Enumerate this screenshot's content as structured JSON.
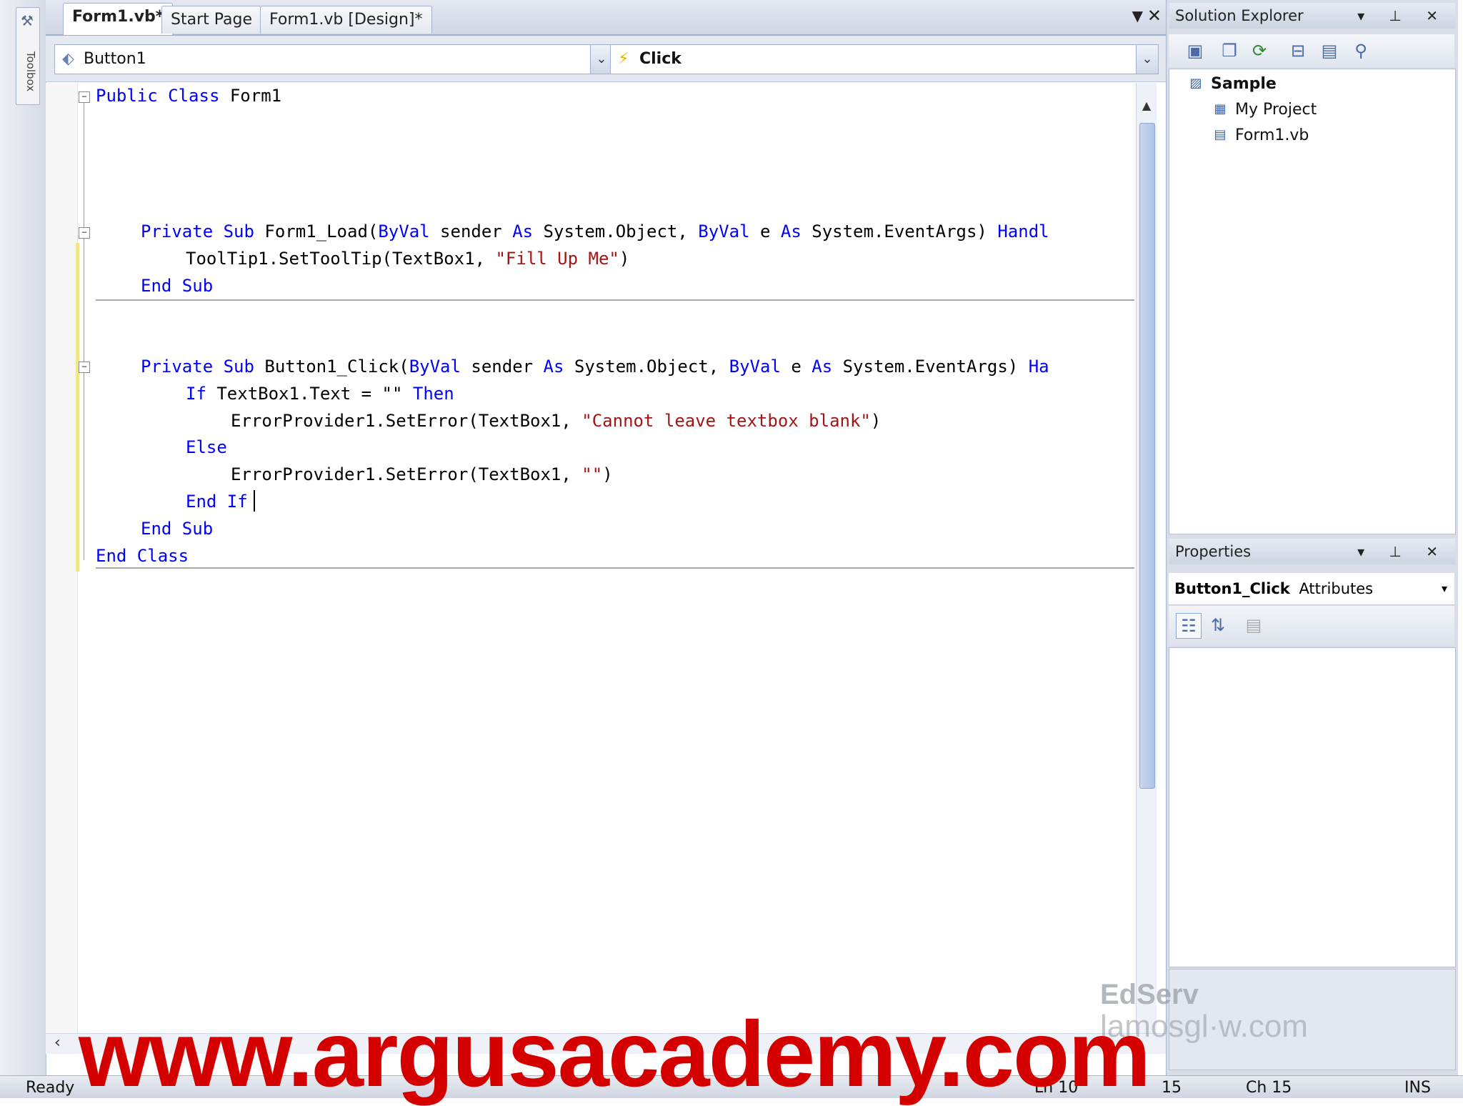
{
  "toolbox": {
    "label": "Toolbox",
    "icon": "toolbox-icon"
  },
  "tabs": [
    {
      "label": "Form1.vb*",
      "active": true
    },
    {
      "label": "Start Page",
      "active": false
    },
    {
      "label": "Form1.vb [Design]*",
      "active": false
    }
  ],
  "nav": {
    "object_combo": "Button1",
    "event_combo": "Click"
  },
  "code": {
    "line1_kw": "Public Class",
    "line1_name": " Form1",
    "load_sig_kw1": "Private Sub",
    "load_sig_name": " Form1_Load(",
    "byval": "ByVal",
    "sender": " sender ",
    "as": "As",
    "sysobj": " System.Object, ",
    "e_txt": " e ",
    "sysevent": " System.EventArgs) ",
    "load_handles": "Handl",
    "tooltip_call": "ToolTip1.SetToolTip(TextBox1, ",
    "tooltip_str": "\"Fill Up Me\"",
    "close_paren": ")",
    "end_sub": "End Sub",
    "click_sig_name": " Button1_Click(",
    "click_handles": "Ha",
    "if_kw": "If",
    "if_cond": " TextBox1.Text = \"\" ",
    "then_kw": "Then",
    "seterr1_call": "ErrorProvider1.SetError(TextBox1, ",
    "seterr1_str": "\"Cannot leave textbox blank\"",
    "else_kw": "Else",
    "seterr2_call": "ErrorProvider1.SetError(TextBox1, ",
    "seterr2_str": "\"\"",
    "end_if": "End If",
    "end_class": "End Class"
  },
  "solution_explorer": {
    "title": "Solution Explorer",
    "controls": "▾ ⊥ ✕",
    "items": [
      {
        "label": "Sample",
        "bold": true
      },
      {
        "label": "My Project",
        "bold": false
      },
      {
        "label": "Form1.vb",
        "bold": false
      }
    ]
  },
  "properties": {
    "title": "Properties",
    "controls": "▾ ⊥ ✕",
    "object_name": "Button1_Click",
    "object_type": "Attributes"
  },
  "status": {
    "text": "Ready",
    "ln": "Ln 10",
    "col": "15",
    "ch": "Ch 15",
    "ins": "INS"
  },
  "watermarks": {
    "url": "www.argusacademy.com",
    "edserv": "EdServ",
    "lamp": "lamosgl·w.com"
  },
  "colors": {
    "keyword": "#0000ff",
    "string": "#a31515",
    "watermark": "#d40000"
  }
}
